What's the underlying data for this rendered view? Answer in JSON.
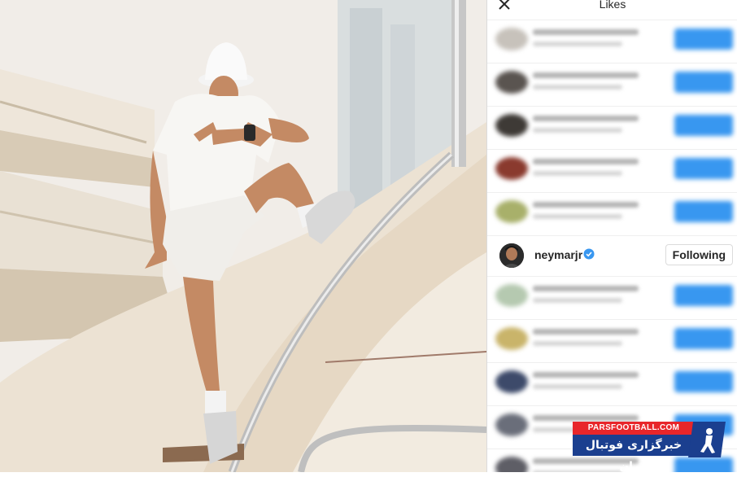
{
  "panel": {
    "title": "Likes",
    "close_icon": "close-icon"
  },
  "likes": {
    "featured": {
      "username": "neymarjr",
      "verified_icon": "verified-badge-icon",
      "button_label": "Following"
    }
  },
  "watermark": {
    "site": "PARSFOOTBALL.COM",
    "tagline": "خبرگزاری فوتبال ایران"
  },
  "colors": {
    "follow_blue": "#3897f0",
    "verified_blue": "#3897f0",
    "watermark_red": "#e8262a",
    "watermark_navy": "#1b3f8f"
  }
}
